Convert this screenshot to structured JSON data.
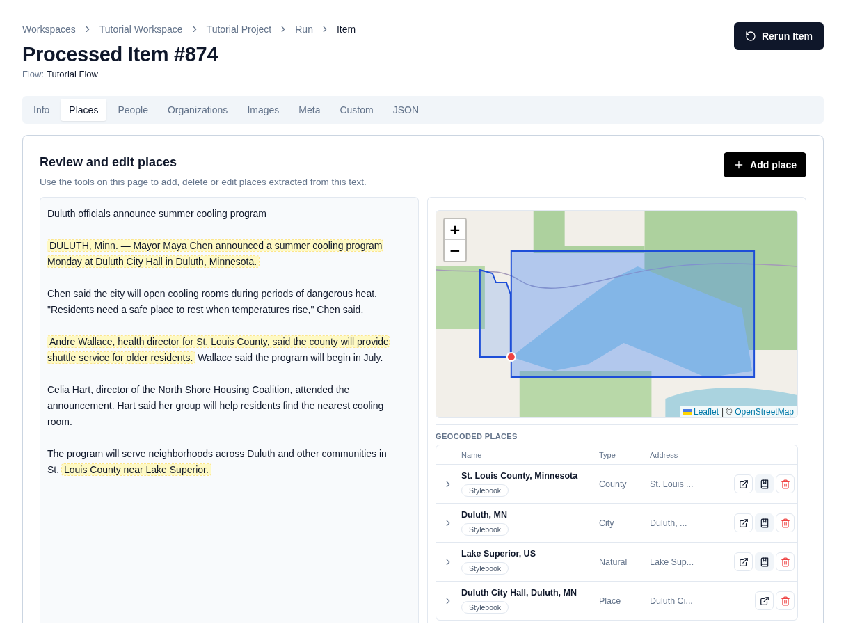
{
  "breadcrumb": [
    {
      "label": "Workspaces",
      "current": false
    },
    {
      "label": "Tutorial Workspace",
      "current": false
    },
    {
      "label": "Tutorial Project",
      "current": false
    },
    {
      "label": "Run",
      "current": false
    },
    {
      "label": "Item",
      "current": true
    }
  ],
  "title": "Processed Item #874",
  "flow": {
    "label": "Flow:",
    "value": "Tutorial Flow"
  },
  "rerun_button": "Rerun Item",
  "tabs": [
    {
      "label": "Info",
      "selected": false
    },
    {
      "label": "Places",
      "selected": true
    },
    {
      "label": "People",
      "selected": false
    },
    {
      "label": "Organizations",
      "selected": false
    },
    {
      "label": "Images",
      "selected": false
    },
    {
      "label": "Meta",
      "selected": false
    },
    {
      "label": "Custom",
      "selected": false
    },
    {
      "label": "JSON",
      "selected": false
    }
  ],
  "card": {
    "title": "Review and edit places",
    "subtitle": "Use the tools on this page to add, delete or edit places extracted from this text.",
    "add_button": "Add place"
  },
  "text_paragraphs": [
    [
      {
        "text": "Duluth officials announce summer cooling program",
        "highlighted": false
      }
    ],
    [
      {
        "text": "DULUTH, Minn. — Mayor Maya Chen announced a summer cooling program Monday at Duluth City Hall in Duluth, Minnesota.",
        "highlighted": true
      }
    ],
    [
      {
        "text": "Chen said the city will open cooling rooms during periods of dangerous heat. \"Residents need a safe place to rest when temperatures rise,\" Chen said.",
        "highlighted": false
      }
    ],
    [
      {
        "text": "Andre Wallace, health director for St. Louis County, said the county will provide shuttle service for older residents.",
        "highlighted": true
      },
      {
        "text": "Wallace said the program will begin in July.",
        "highlighted": false
      }
    ],
    [
      {
        "text": "Celia Hart, director of the North Shore Housing Coalition, attended the announcement. Hart said her group will help residents find the nearest cooling room.",
        "highlighted": false
      }
    ],
    [
      {
        "text": "The program will serve neighborhoods across Duluth and other communities in St.",
        "highlighted": false
      },
      {
        "text": "Louis County near Lake Superior.",
        "highlighted": true
      }
    ]
  ],
  "map": {
    "kind": "picture",
    "zoom_in": "+",
    "zoom_out": "−",
    "attribution": {
      "link": "Leaflet",
      "separator": "| ©",
      "source": "OpenStreetMap"
    }
  },
  "geocoded": {
    "heading": "GEOCODED PLACES",
    "columns": [
      "Name",
      "Type",
      "Address"
    ],
    "rows": [
      {
        "name": "St. Louis County, Minnesota",
        "tag": "Stylebook",
        "type": "County",
        "address": "St. Louis ...",
        "actions": [
          {
            "kind": "open"
          },
          {
            "kind": "stylebook"
          },
          {
            "kind": "delete"
          }
        ]
      },
      {
        "name": "Duluth, MN",
        "tag": "Stylebook",
        "type": "City",
        "address": "Duluth, ...",
        "actions": [
          {
            "kind": "open"
          },
          {
            "kind": "stylebook"
          },
          {
            "kind": "delete"
          }
        ]
      },
      {
        "name": "Lake Superior, US",
        "tag": "Stylebook",
        "type": "Natural",
        "address": "Lake Sup...",
        "actions": [
          {
            "kind": "open"
          },
          {
            "kind": "stylebook"
          },
          {
            "kind": "delete"
          }
        ]
      },
      {
        "name": "Duluth City Hall, Duluth, MN",
        "tag": "Stylebook",
        "type": "Place",
        "address": "Duluth Ci...",
        "actions": [
          {
            "kind": "open"
          },
          {
            "kind": "delete"
          }
        ]
      }
    ]
  }
}
